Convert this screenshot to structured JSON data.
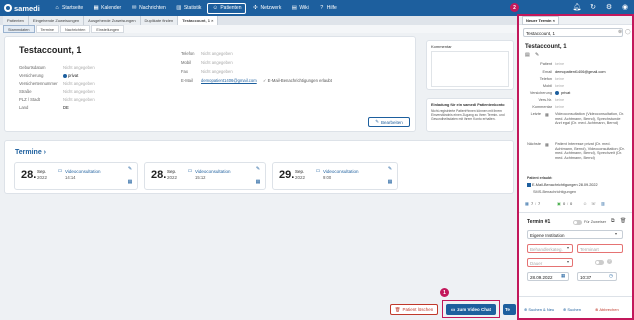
{
  "app": {
    "logo_text": "samedi"
  },
  "nav": [
    {
      "label": "Startseite",
      "icon": "home-icon",
      "glyph": "⌂"
    },
    {
      "label": "Kalender",
      "icon": "calendar-icon",
      "glyph": "▦"
    },
    {
      "label": "Nachrichten",
      "icon": "mail-icon",
      "glyph": "✉"
    },
    {
      "label": "Statistik",
      "icon": "chart-icon",
      "glyph": "▥"
    },
    {
      "label": "Patienten",
      "icon": "patients-icon",
      "glyph": "☺"
    },
    {
      "label": "Netzwerk",
      "icon": "network-icon",
      "glyph": "✣"
    },
    {
      "label": "Wiki",
      "icon": "wiki-icon",
      "glyph": "▤"
    },
    {
      "label": "Hilfe",
      "icon": "help-icon",
      "glyph": "?"
    }
  ],
  "tabs_top": [
    "Patienten",
    "Eingehende Zuweisungen",
    "Ausgehende Zuweisungen",
    "Duplikate finden",
    "Testaccount, 1"
  ],
  "tabs_top_close": "×",
  "tabs_sub": [
    "Stammdaten",
    "Termine",
    "Nachrichten",
    "Einstellungen"
  ],
  "patient": {
    "name": "Testaccount, 1",
    "left_fields": [
      {
        "label": "Geburtsdatum",
        "value": "Nicht angegeben"
      },
      {
        "label": "Versicherung",
        "value": "privat"
      },
      {
        "label": "Versichertennummer",
        "value": "Nicht angegeben"
      },
      {
        "label": "Straße",
        "value": "Nicht angegeben"
      },
      {
        "label": "PLZ / Stadt",
        "value": "Nicht angegeben"
      },
      {
        "label": "Land",
        "value": "DE"
      }
    ],
    "right_fields": [
      {
        "label": "Telefon",
        "value": "Nicht angegeben"
      },
      {
        "label": "Mobil",
        "value": "Nicht angegeben"
      },
      {
        "label": "Fax",
        "value": "Nicht angegeben"
      },
      {
        "label": "E-Mail",
        "value": "demopatient1406@gmail.com",
        "extra": "✓ E-Mail-Benachrichtigungen erlaubt"
      }
    ],
    "edit_label": "Bearbeiten"
  },
  "comment_box": {
    "title": "Kommentar"
  },
  "consent_box": {
    "title": "Einladung für ein samedi Patientenkonto",
    "text": "Nicht-registrierte Patient*innen können mit ihrem Einverständnis einen Zugang zu ihren Termin- und Gesundheitsdaten mit ihrem Konto erhalten."
  },
  "appointments": {
    "title": "Termine",
    "items": [
      {
        "day": "28.",
        "month": "Sep.",
        "year": "2022",
        "type": "Videoconsultation",
        "time": "14:14"
      },
      {
        "day": "28.",
        "month": "Sep.",
        "year": "2022",
        "type": "Videoconsultation",
        "time": "15:12"
      },
      {
        "day": "29.",
        "month": "Sep.",
        "year": "2022",
        "type": "Videoconsultation",
        "time": "9:00"
      }
    ]
  },
  "actions": {
    "delete": "Patient löschen",
    "video_chat": "zum Video Chat",
    "te": "Te"
  },
  "badges": {
    "one": "1",
    "two": "2"
  },
  "panel": {
    "tab": "Neuer Termin",
    "tab_close": "×",
    "search_value": "Testaccount, 1",
    "name": "Testaccount, 1",
    "rows": [
      {
        "label": "Patient",
        "value": "keine"
      },
      {
        "label": "Email",
        "value": "demopatient1406@gmail.com"
      },
      {
        "label": "Telefon",
        "value": "keine"
      },
      {
        "label": "Mobil",
        "value": "keine"
      },
      {
        "label": "Versicherung",
        "value": "privat"
      },
      {
        "label": "Vers.Nr.",
        "value": "keine"
      },
      {
        "label": "Kommentar",
        "value": "keine"
      },
      {
        "label": "Letzte",
        "value": "Videoconsultation (Videoconsultation, Dr. med. Achtmann, Bernd), Sprechstunde Arzt egal (Dr. med. Achtmann, Bernd)"
      },
      {
        "label": "Nächste",
        "value": "Patient Interesse privat (Dr. med. Achtmann, Bernd), Videoconsultation (Dr. med. Achtmann, Bernd), Sprechzeit (Dr. med. Achtmann, Bernd)"
      }
    ],
    "allowed_label": "Patient erlaubt:",
    "email_allowed": "E-Mail-Benachrichtigungen 28.09.2022",
    "sms": "SMS-Benachrichtigungen",
    "stats": [
      "7",
      "7",
      "0",
      "0"
    ],
    "termin_title": "Termin #1",
    "fuer_zuweiser": "Für Zuweiser",
    "institution": "Eigene Institution",
    "category_placeholder": "Behandlerkateg.",
    "terminart_placeholder": "Terminart",
    "dauer_placeholder": "Dauer",
    "date": "28.09.2022",
    "time": "10:37",
    "footer": {
      "search_new": "Suchen & Neu",
      "search": "Suchen",
      "cancel": "Abbrechen"
    }
  },
  "colors": {
    "brand": "#1d5f9e",
    "highlight": "#c2185b",
    "danger": "#c0392b"
  }
}
